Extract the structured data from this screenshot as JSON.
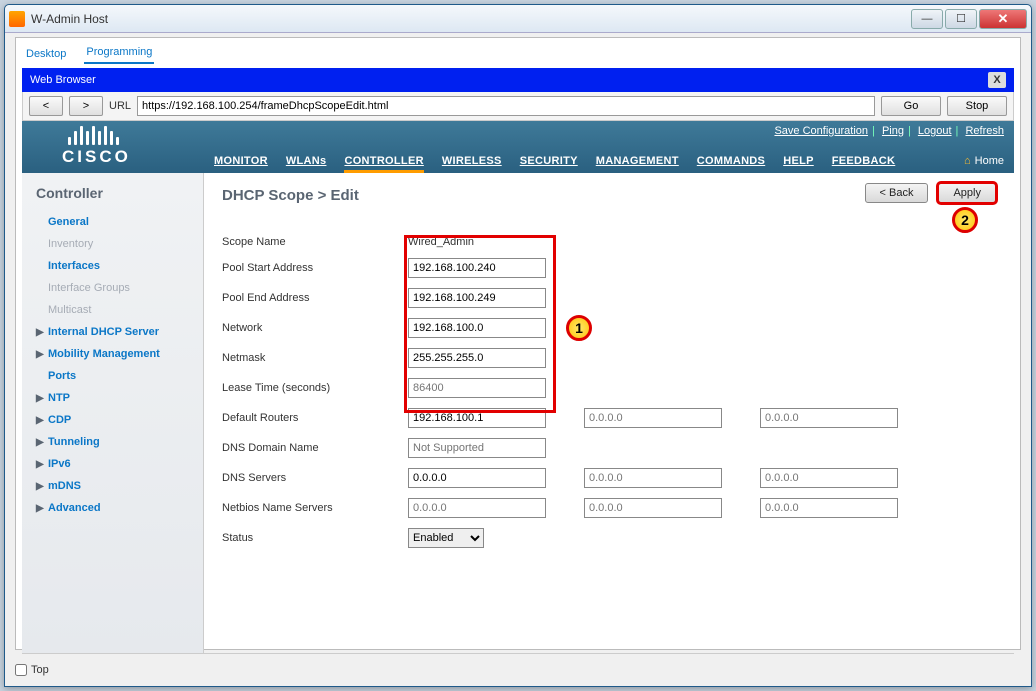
{
  "window": {
    "title": "W-Admin Host",
    "min": "—",
    "max": "☐",
    "close": "✕"
  },
  "tabs": {
    "desktop": "Desktop",
    "programming": "Programming"
  },
  "browser": {
    "head": "Web Browser",
    "back": "<",
    "fwd": ">",
    "urllabel": "URL",
    "url": "https://192.168.100.254/frameDhcpScopeEdit.html",
    "go": "Go",
    "stop": "Stop",
    "close": "X"
  },
  "cisco": {
    "logo": "CISCO"
  },
  "toplinks": {
    "save": "Save Configuration",
    "ping": "Ping",
    "logout": "Logout",
    "refresh": "Refresh"
  },
  "nav": {
    "monitor": "MONITOR",
    "wlans": "WLANs",
    "controller": "CONTROLLER",
    "wireless": "WIRELESS",
    "security": "SECURITY",
    "management": "MANAGEMENT",
    "commands": "COMMANDS",
    "help": "HELP",
    "feedback": "FEEDBACK",
    "home": "Home"
  },
  "side": {
    "title": "Controller",
    "items": [
      {
        "label": "General",
        "cls": "bold"
      },
      {
        "label": "Inventory",
        "cls": "dim"
      },
      {
        "label": "Interfaces",
        "cls": "bold"
      },
      {
        "label": "Interface Groups",
        "cls": "dim"
      },
      {
        "label": "Multicast",
        "cls": "dim"
      },
      {
        "label": "Internal DHCP Server",
        "cls": "bold has"
      },
      {
        "label": "Mobility Management",
        "cls": "bold has"
      },
      {
        "label": "Ports",
        "cls": "bold"
      },
      {
        "label": "NTP",
        "cls": "bold has"
      },
      {
        "label": "CDP",
        "cls": "bold has"
      },
      {
        "label": "Tunneling",
        "cls": "bold has"
      },
      {
        "label": "IPv6",
        "cls": "bold has"
      },
      {
        "label": "mDNS",
        "cls": "bold has"
      },
      {
        "label": "Advanced",
        "cls": "bold has"
      }
    ]
  },
  "page": {
    "title": "DHCP Scope > Edit",
    "back": "< Back",
    "apply": "Apply"
  },
  "form": {
    "scope_label": "Scope Name",
    "scope_value": "Wired_Admin",
    "pool_start_label": "Pool Start Address",
    "pool_start": "192.168.100.240",
    "pool_end_label": "Pool End Address",
    "pool_end": "192.168.100.249",
    "network_label": "Network",
    "network_value": "192.168.100.0",
    "netmask_label": "Netmask",
    "netmask_value": "255.255.255.0",
    "lease_label": "Lease Time (seconds)",
    "lease_value": "86400",
    "router_label": "Default Routers",
    "router1": "192.168.100.1",
    "ph": "0.0.0.0",
    "dnsname_label": "DNS Domain Name",
    "dnsname_ph": "Not Supported",
    "dnssrv_label": "DNS Servers",
    "dnssrv1": "0.0.0.0",
    "nb_label": "Netbios Name Servers",
    "status_label": "Status",
    "status_value": "Enabled"
  },
  "markers": {
    "one": "1",
    "two": "2"
  },
  "footer": {
    "top": "Top"
  }
}
